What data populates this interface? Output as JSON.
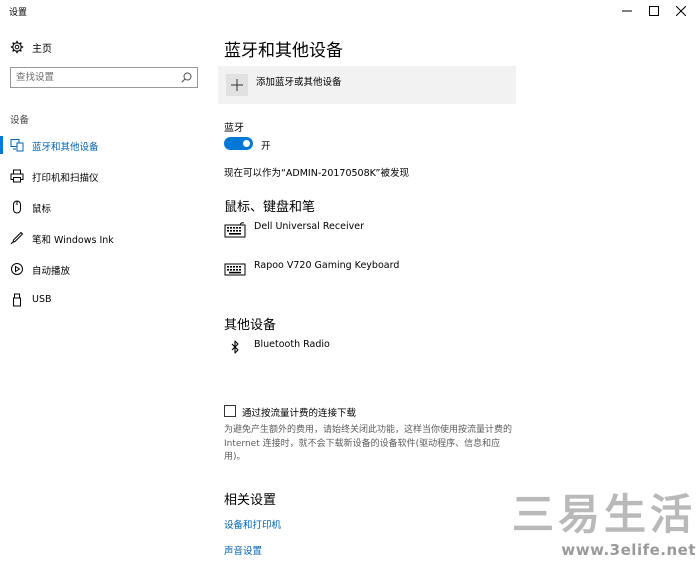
{
  "window": {
    "title": "设置",
    "minimize_glyph": "—",
    "maximize_glyph": "☐",
    "close_glyph": "✕"
  },
  "sidebar": {
    "home_label": "主页",
    "search_placeholder": "查找设置",
    "section_label": "设备",
    "items": [
      {
        "label": "蓝牙和其他设备",
        "icon": "bluetooth-devices-icon",
        "active": true
      },
      {
        "label": "打印机和扫描仪",
        "icon": "printer-icon",
        "active": false
      },
      {
        "label": "鼠标",
        "icon": "mouse-icon",
        "active": false
      },
      {
        "label": "笔和 Windows Ink",
        "icon": "pen-icon",
        "active": false
      },
      {
        "label": "自动播放",
        "icon": "autoplay-icon",
        "active": false
      },
      {
        "label": "USB",
        "icon": "usb-icon",
        "active": false
      }
    ]
  },
  "main": {
    "title": "蓝牙和其他设备",
    "add_device_label": "添加蓝牙或其他设备",
    "bluetooth_label": "蓝牙",
    "bluetooth_state": "开",
    "discoverable_text": "现在可以作为“ADMIN-20170508K”被发现",
    "mouse_section": {
      "title": "鼠标、键盘和笔",
      "devices": [
        {
          "name": "Dell Universal Receiver",
          "icon": "keyboard-icon"
        },
        {
          "name": "Rapoo V720 Gaming Keyboard",
          "icon": "keyboard-icon"
        }
      ]
    },
    "other_section": {
      "title": "其他设备",
      "devices": [
        {
          "name": "Bluetooth Radio",
          "icon": "bluetooth-icon"
        }
      ]
    },
    "metered_label": "通过按流量计费的连接下载",
    "metered_description": "为避免产生额外的费用，请始终关闭此功能，这样当你使用按流量计费的 Internet 连接时，就不会下载新设备的设备软件(驱动程序、信息和应用)。",
    "related_title": "相关设置",
    "related_links": [
      "设备和打印机",
      "声音设置"
    ]
  },
  "watermark": {
    "text": "三易生活",
    "url": "www.3elife.net"
  },
  "colors": {
    "accent": "#0078d7",
    "link": "#0063b1",
    "add_device_bg": "#f2f2f2"
  }
}
